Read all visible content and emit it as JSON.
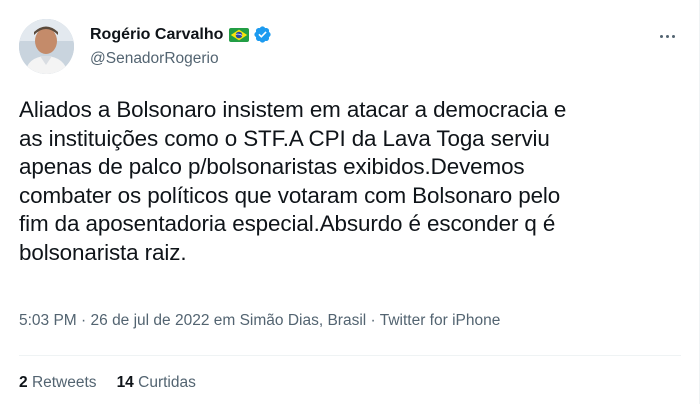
{
  "author": {
    "name": "Rogério Carvalho",
    "handle": "@SenadorRogerio",
    "flag_icon": "brazil-flag-icon",
    "verified_icon": "verified-badge-icon",
    "verified_color": "#1d9bf0"
  },
  "tweet": {
    "text": "Aliados a Bolsonaro insistem em atacar a democracia e\nas instituições como o STF.A CPI da Lava Toga serviu\napenas de palco p/bolsonaristas exibidos.Devemos\ncombater os políticos que votaram com Bolsonaro pelo\nfim da aposentadoria especial.Absurdo é esconder q é\nbolsonarista raiz.",
    "time": "5:03 PM",
    "separator1": " · ",
    "date_location": "26 de jul de 2022 em Simão Dias, Brasil",
    "separator2": " · ",
    "source": "Twitter for iPhone"
  },
  "stats": {
    "retweets_count": "2",
    "retweets_label": "Retweets",
    "likes_count": "14",
    "likes_label": "Curtidas"
  },
  "menu": {
    "more_icon": "more-options-icon"
  }
}
